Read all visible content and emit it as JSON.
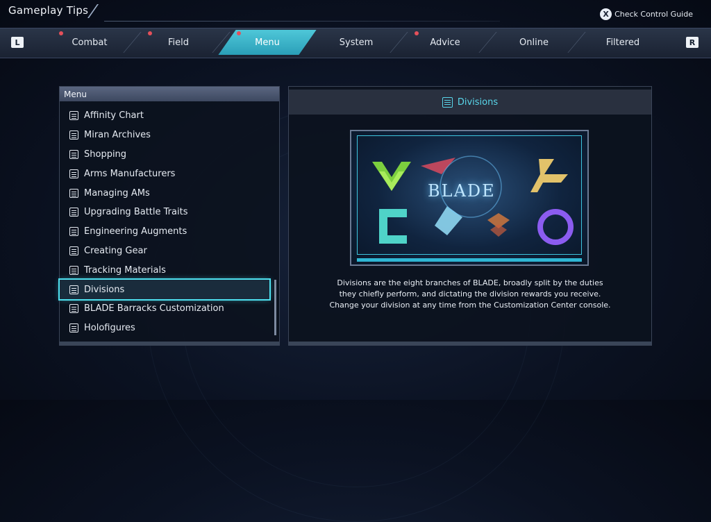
{
  "header": {
    "title": "Gameplay Tips",
    "guide_button": "X",
    "guide_label": "Check Control Guide"
  },
  "shoulders": {
    "left": "L",
    "right": "R"
  },
  "tabs": [
    {
      "label": "Combat",
      "dot": true
    },
    {
      "label": "Field",
      "dot": true
    },
    {
      "label": "Menu",
      "dot": true,
      "active": true
    },
    {
      "label": "System",
      "dot": false
    },
    {
      "label": "Advice",
      "dot": true
    },
    {
      "label": "Online",
      "dot": false
    },
    {
      "label": "Filtered",
      "dot": false
    }
  ],
  "menu": {
    "title": "Menu",
    "items": [
      {
        "label": "Affinity Chart"
      },
      {
        "label": "Miran Archives"
      },
      {
        "label": "Shopping"
      },
      {
        "label": "Arms Manufacturers"
      },
      {
        "label": "Managing AMs"
      },
      {
        "label": "Upgrading Battle Traits"
      },
      {
        "label": "Engineering Augments"
      },
      {
        "label": "Creating Gear"
      },
      {
        "label": "Tracking Materials"
      },
      {
        "label": "Divisions",
        "selected": true
      },
      {
        "label": "BLADE Barracks Customization"
      },
      {
        "label": "Holofigures"
      }
    ]
  },
  "detail": {
    "title": "Divisions",
    "image_text": "BLADE",
    "description": [
      "Divisions are the eight branches of BLADE, broadly split by the duties",
      "they chiefly perform, and dictating the division rewards you receive.",
      "Change your division at any time from the Customization Center console."
    ]
  },
  "colors": {
    "accent": "#4ee0ef",
    "tab_active": "#2a9fb8",
    "dot": "#e4505a"
  }
}
